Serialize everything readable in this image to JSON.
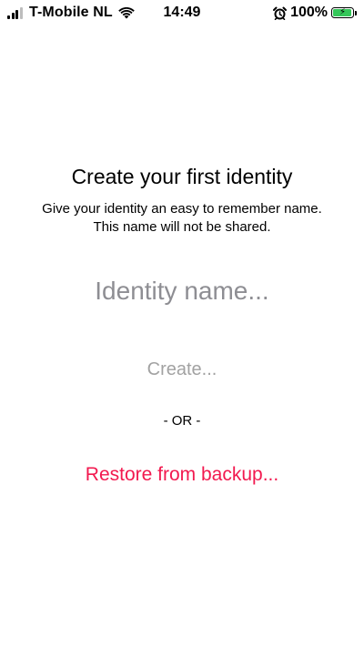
{
  "status_bar": {
    "carrier": "T-Mobile NL",
    "time": "14:49",
    "battery_percent": "100%",
    "signal_bars_active": 3,
    "signal_bars_total": 4,
    "battery_level": 1.0,
    "battery_charging": true,
    "icons": [
      "cellular-signal-icon",
      "wifi-icon",
      "alarm-icon",
      "battery-icon",
      "charging-bolt-icon"
    ],
    "battery_color": "#34c759"
  },
  "screen": {
    "title": "Create your first identity",
    "subtitle": "Give your identity an easy to remember name. This name will not be shared.",
    "identity_input": {
      "placeholder": "Identity name...",
      "value": ""
    },
    "create_label": "Create...",
    "or_label": "- OR -",
    "restore_label": "Restore from backup..."
  },
  "colors": {
    "background": "#ffffff",
    "text": "#000000",
    "placeholder": "#8e8e93",
    "disabled_button": "#a2a2a2",
    "accent": "#f2194f"
  }
}
